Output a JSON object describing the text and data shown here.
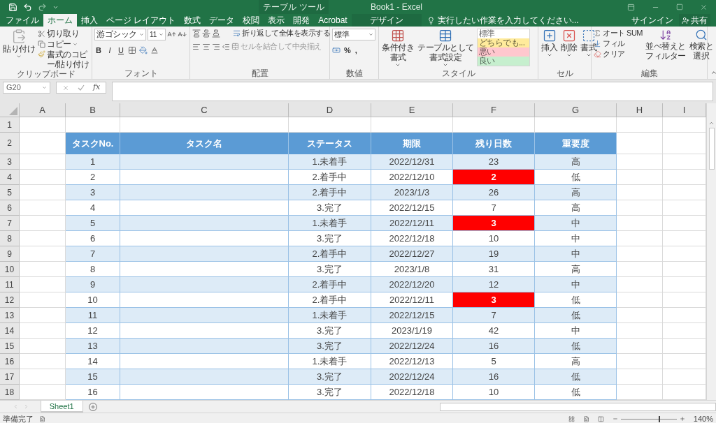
{
  "title_bar": {
    "context_label": "テーブル ツール",
    "title": "Book1 - Excel"
  },
  "tabs": [
    {
      "label": "ファイル",
      "selected": false,
      "kind": "normal"
    },
    {
      "label": "ホーム",
      "selected": true,
      "kind": "normal"
    },
    {
      "label": "挿入",
      "selected": false,
      "kind": "normal"
    },
    {
      "label": "ページ レイアウト",
      "selected": false,
      "kind": "normal"
    },
    {
      "label": "数式",
      "selected": false,
      "kind": "normal"
    },
    {
      "label": "データ",
      "selected": false,
      "kind": "normal"
    },
    {
      "label": "校閲",
      "selected": false,
      "kind": "normal"
    },
    {
      "label": "表示",
      "selected": false,
      "kind": "normal"
    },
    {
      "label": "開発",
      "selected": false,
      "kind": "normal"
    },
    {
      "label": "Acrobat",
      "selected": false,
      "kind": "normal"
    },
    {
      "label": "デザイン",
      "selected": false,
      "kind": "contextual"
    }
  ],
  "tell_me": "実行したい作業を入力してください...",
  "sign_in": "サインイン",
  "share": "共有",
  "ribbon": {
    "clipboard": {
      "paste": "貼り付け",
      "cut": "切り取り",
      "copy": "コピー",
      "format_painter": "書式のコピー/貼り付け",
      "label": "クリップボード"
    },
    "font": {
      "name": "游ゴシック",
      "size": "11",
      "styles": [
        "B",
        "I",
        "U"
      ],
      "label": "フォント"
    },
    "alignment": {
      "wrap": "折り返して全体を表示する",
      "merge": "セルを結合して中央揃え",
      "merge_disabled": true,
      "label": "配置"
    },
    "number": {
      "format": "標準",
      "buttons": [
        "%",
        ","
      ],
      "label": "数値"
    },
    "styles": {
      "conditional": [
        "条件付き",
        "書式"
      ],
      "table": [
        "テーブルとして",
        "書式設定"
      ],
      "cell_styles": [
        {
          "label": "標準",
          "color": "#ffffff"
        },
        {
          "label": "どちらでも...",
          "color": "#ffeb9c"
        },
        {
          "label": "悪い",
          "color": "#ffc7ce"
        },
        {
          "label": "良い",
          "color": "#c6efce"
        }
      ],
      "label": "スタイル"
    },
    "cells": {
      "buttons": [
        "挿入",
        "削除",
        "書式"
      ],
      "label": "セル"
    },
    "editing": {
      "autosum": "オート SUM",
      "fill": "フィル",
      "clear": "クリア",
      "sort": [
        "並べ替えと",
        "フィルター"
      ],
      "find": [
        "検索と",
        "選択"
      ],
      "label": "編集"
    }
  },
  "formula_bar": {
    "name_box": "G20",
    "fx": "fx"
  },
  "sheet": {
    "columns": [
      "A",
      "B",
      "C",
      "D",
      "E",
      "F",
      "G",
      "H",
      "I"
    ],
    "rows": [
      "1",
      "2",
      "3",
      "4",
      "5",
      "6",
      "7",
      "8",
      "9",
      "10",
      "11",
      "12",
      "13",
      "14",
      "15",
      "16",
      "17",
      "18"
    ]
  },
  "table": {
    "columns": [
      "タスクNo.",
      "タスク名",
      "ステータス",
      "期限",
      "残り日数",
      "重要度"
    ],
    "rows": [
      {
        "cells": [
          "1",
          "",
          "1.未着手",
          "2022/12/31",
          "23",
          "高"
        ],
        "alert": false
      },
      {
        "cells": [
          "2",
          "",
          "2.着手中",
          "2022/12/10",
          "2",
          "低"
        ],
        "alert": true
      },
      {
        "cells": [
          "3",
          "",
          "2.着手中",
          "2023/1/3",
          "26",
          "高"
        ],
        "alert": false
      },
      {
        "cells": [
          "4",
          "",
          "3.完了",
          "2022/12/15",
          "7",
          "高"
        ],
        "alert": false
      },
      {
        "cells": [
          "5",
          "",
          "1.未着手",
          "2022/12/11",
          "3",
          "中"
        ],
        "alert": true
      },
      {
        "cells": [
          "6",
          "",
          "3.完了",
          "2022/12/18",
          "10",
          "中"
        ],
        "alert": false
      },
      {
        "cells": [
          "7",
          "",
          "2.着手中",
          "2022/12/27",
          "19",
          "中"
        ],
        "alert": false
      },
      {
        "cells": [
          "8",
          "",
          "3.完了",
          "2023/1/8",
          "31",
          "高"
        ],
        "alert": false
      },
      {
        "cells": [
          "9",
          "",
          "2.着手中",
          "2022/12/20",
          "12",
          "中"
        ],
        "alert": false
      },
      {
        "cells": [
          "10",
          "",
          "2.着手中",
          "2022/12/11",
          "3",
          "低"
        ],
        "alert": true
      },
      {
        "cells": [
          "11",
          "",
          "1.未着手",
          "2022/12/15",
          "7",
          "低"
        ],
        "alert": false
      },
      {
        "cells": [
          "12",
          "",
          "3.完了",
          "2023/1/19",
          "42",
          "中"
        ],
        "alert": false
      },
      {
        "cells": [
          "13",
          "",
          "3.完了",
          "2022/12/24",
          "16",
          "低"
        ],
        "alert": false
      },
      {
        "cells": [
          "14",
          "",
          "1.未着手",
          "2022/12/13",
          "5",
          "高"
        ],
        "alert": false
      },
      {
        "cells": [
          "15",
          "",
          "3.完了",
          "2022/12/24",
          "16",
          "低"
        ],
        "alert": false
      },
      {
        "cells": [
          "16",
          "",
          "3.完了",
          "2022/12/18",
          "10",
          "低"
        ],
        "alert": false
      }
    ]
  },
  "sheet_tabs": [
    {
      "label": "Sheet1",
      "selected": true
    }
  ],
  "status": "準備完了",
  "zoom_slider": {
    "level": 0.7
  },
  "zoom": "140%"
}
